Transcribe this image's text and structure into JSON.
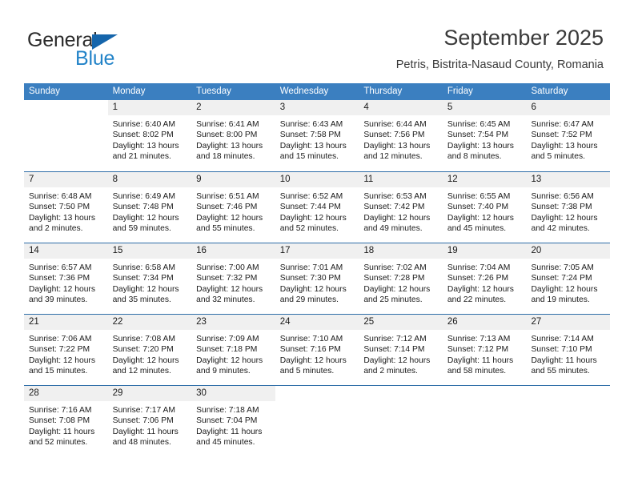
{
  "brand": {
    "word_one": "General",
    "word_two": "Blue",
    "flag_icon": "triangle-flag-icon"
  },
  "header": {
    "title": "September 2025",
    "subtitle": "Petris, Bistrita-Nasaud County, Romania"
  },
  "colors": {
    "header_blue": "#3b7fc0",
    "separator_blue": "#2f6ea8",
    "day_number_bg": "#f0f0f0",
    "brand_blue": "#2283c8",
    "brand_flag": "#1565ab",
    "text": "#1a1a1a"
  },
  "calendar": {
    "weekdays": [
      "Sunday",
      "Monday",
      "Tuesday",
      "Wednesday",
      "Thursday",
      "Friday",
      "Saturday"
    ],
    "weeks": [
      [
        {
          "day": "",
          "lines": []
        },
        {
          "day": "1",
          "lines": [
            "Sunrise: 6:40 AM",
            "Sunset: 8:02 PM",
            "Daylight: 13 hours",
            "and 21 minutes."
          ]
        },
        {
          "day": "2",
          "lines": [
            "Sunrise: 6:41 AM",
            "Sunset: 8:00 PM",
            "Daylight: 13 hours",
            "and 18 minutes."
          ]
        },
        {
          "day": "3",
          "lines": [
            "Sunrise: 6:43 AM",
            "Sunset: 7:58 PM",
            "Daylight: 13 hours",
            "and 15 minutes."
          ]
        },
        {
          "day": "4",
          "lines": [
            "Sunrise: 6:44 AM",
            "Sunset: 7:56 PM",
            "Daylight: 13 hours",
            "and 12 minutes."
          ]
        },
        {
          "day": "5",
          "lines": [
            "Sunrise: 6:45 AM",
            "Sunset: 7:54 PM",
            "Daylight: 13 hours",
            "and 8 minutes."
          ]
        },
        {
          "day": "6",
          "lines": [
            "Sunrise: 6:47 AM",
            "Sunset: 7:52 PM",
            "Daylight: 13 hours",
            "and 5 minutes."
          ]
        }
      ],
      [
        {
          "day": "7",
          "lines": [
            "Sunrise: 6:48 AM",
            "Sunset: 7:50 PM",
            "Daylight: 13 hours",
            "and 2 minutes."
          ]
        },
        {
          "day": "8",
          "lines": [
            "Sunrise: 6:49 AM",
            "Sunset: 7:48 PM",
            "Daylight: 12 hours",
            "and 59 minutes."
          ]
        },
        {
          "day": "9",
          "lines": [
            "Sunrise: 6:51 AM",
            "Sunset: 7:46 PM",
            "Daylight: 12 hours",
            "and 55 minutes."
          ]
        },
        {
          "day": "10",
          "lines": [
            "Sunrise: 6:52 AM",
            "Sunset: 7:44 PM",
            "Daylight: 12 hours",
            "and 52 minutes."
          ]
        },
        {
          "day": "11",
          "lines": [
            "Sunrise: 6:53 AM",
            "Sunset: 7:42 PM",
            "Daylight: 12 hours",
            "and 49 minutes."
          ]
        },
        {
          "day": "12",
          "lines": [
            "Sunrise: 6:55 AM",
            "Sunset: 7:40 PM",
            "Daylight: 12 hours",
            "and 45 minutes."
          ]
        },
        {
          "day": "13",
          "lines": [
            "Sunrise: 6:56 AM",
            "Sunset: 7:38 PM",
            "Daylight: 12 hours",
            "and 42 minutes."
          ]
        }
      ],
      [
        {
          "day": "14",
          "lines": [
            "Sunrise: 6:57 AM",
            "Sunset: 7:36 PM",
            "Daylight: 12 hours",
            "and 39 minutes."
          ]
        },
        {
          "day": "15",
          "lines": [
            "Sunrise: 6:58 AM",
            "Sunset: 7:34 PM",
            "Daylight: 12 hours",
            "and 35 minutes."
          ]
        },
        {
          "day": "16",
          "lines": [
            "Sunrise: 7:00 AM",
            "Sunset: 7:32 PM",
            "Daylight: 12 hours",
            "and 32 minutes."
          ]
        },
        {
          "day": "17",
          "lines": [
            "Sunrise: 7:01 AM",
            "Sunset: 7:30 PM",
            "Daylight: 12 hours",
            "and 29 minutes."
          ]
        },
        {
          "day": "18",
          "lines": [
            "Sunrise: 7:02 AM",
            "Sunset: 7:28 PM",
            "Daylight: 12 hours",
            "and 25 minutes."
          ]
        },
        {
          "day": "19",
          "lines": [
            "Sunrise: 7:04 AM",
            "Sunset: 7:26 PM",
            "Daylight: 12 hours",
            "and 22 minutes."
          ]
        },
        {
          "day": "20",
          "lines": [
            "Sunrise: 7:05 AM",
            "Sunset: 7:24 PM",
            "Daylight: 12 hours",
            "and 19 minutes."
          ]
        }
      ],
      [
        {
          "day": "21",
          "lines": [
            "Sunrise: 7:06 AM",
            "Sunset: 7:22 PM",
            "Daylight: 12 hours",
            "and 15 minutes."
          ]
        },
        {
          "day": "22",
          "lines": [
            "Sunrise: 7:08 AM",
            "Sunset: 7:20 PM",
            "Daylight: 12 hours",
            "and 12 minutes."
          ]
        },
        {
          "day": "23",
          "lines": [
            "Sunrise: 7:09 AM",
            "Sunset: 7:18 PM",
            "Daylight: 12 hours",
            "and 9 minutes."
          ]
        },
        {
          "day": "24",
          "lines": [
            "Sunrise: 7:10 AM",
            "Sunset: 7:16 PM",
            "Daylight: 12 hours",
            "and 5 minutes."
          ]
        },
        {
          "day": "25",
          "lines": [
            "Sunrise: 7:12 AM",
            "Sunset: 7:14 PM",
            "Daylight: 12 hours",
            "and 2 minutes."
          ]
        },
        {
          "day": "26",
          "lines": [
            "Sunrise: 7:13 AM",
            "Sunset: 7:12 PM",
            "Daylight: 11 hours",
            "and 58 minutes."
          ]
        },
        {
          "day": "27",
          "lines": [
            "Sunrise: 7:14 AM",
            "Sunset: 7:10 PM",
            "Daylight: 11 hours",
            "and 55 minutes."
          ]
        }
      ],
      [
        {
          "day": "28",
          "lines": [
            "Sunrise: 7:16 AM",
            "Sunset: 7:08 PM",
            "Daylight: 11 hours",
            "and 52 minutes."
          ]
        },
        {
          "day": "29",
          "lines": [
            "Sunrise: 7:17 AM",
            "Sunset: 7:06 PM",
            "Daylight: 11 hours",
            "and 48 minutes."
          ]
        },
        {
          "day": "30",
          "lines": [
            "Sunrise: 7:18 AM",
            "Sunset: 7:04 PM",
            "Daylight: 11 hours",
            "and 45 minutes."
          ]
        },
        {
          "day": "",
          "lines": []
        },
        {
          "day": "",
          "lines": []
        },
        {
          "day": "",
          "lines": []
        },
        {
          "day": "",
          "lines": []
        }
      ]
    ]
  }
}
